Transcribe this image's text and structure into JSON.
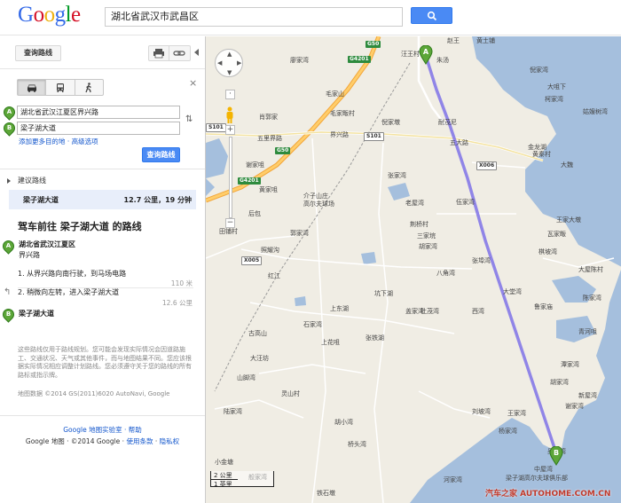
{
  "header": {
    "logo_letters": [
      "G",
      "o",
      "o",
      "g",
      "l",
      "e"
    ],
    "logo_colors": [
      "#3369e8",
      "#d50f25",
      "#eeb211",
      "#3369e8",
      "#009925",
      "#d50f25"
    ],
    "search_value": "湖北省武汉市武昌区"
  },
  "panel": {
    "top_button": "查询路线",
    "waypoints": [
      {
        "marker": "A",
        "value": "湖北省武汉江夏区界兴路"
      },
      {
        "marker": "B",
        "value": "梁子湖大道"
      }
    ],
    "add_destination": "添加更多目的地 · 高级选项",
    "get_directions_button": "查询路线",
    "suggested_label": "建议路线",
    "route": {
      "name": "梁子湖大道",
      "summary": "12.7 公里，19 分钟"
    },
    "directions_title": "驾车前往 梁子湖大道 的路线",
    "start": {
      "marker": "A",
      "line1": "湖北省武汉江夏区",
      "line2": "界兴路"
    },
    "steps": [
      {
        "text": "1. 从界兴路向南行驶，到马场电路",
        "distance": "110 米"
      },
      {
        "text": "2. 稍微向左转，进入梁子湖大道",
        "distance": "12.6 公里"
      }
    ],
    "end": {
      "marker": "B",
      "line1": "梁子湖大道"
    },
    "disclaimer": "这些路线仅用于路线规划。您可能会发现实际情况会因道路施工、交通状况、天气或其他事件，而与地图结果不同。您应该根据实际情况相应调整计划路线。您必须遵守关于您的路线的所有路标或指示牌。",
    "map_data": "地图数据 ©2014 GS(2011)6020 AutoNavi, Google",
    "footer_line1": "Google 地图实验室 · 帮助",
    "footer_line2_prefix": "Google 地图 · ©2014 Google · ",
    "footer_terms": "使用条款",
    "footer_privacy": "隐私权"
  },
  "map": {
    "scale_top": "2 公里",
    "scale_bottom": "1 英里",
    "watermark": "汽车之家  AUTOHOME.COM.CN",
    "route_color": "#7f72e8",
    "water_color": "#a5bfdd",
    "land_color": "#f0ede4",
    "labels": [
      "汪王村",
      "赵王",
      "黄土铺",
      "朱汤",
      "倪家湾",
      "大咀下",
      "柯家湾",
      "毛家山",
      "廖家湾",
      "肖郭家",
      "毛家畈村",
      "耐茂尼",
      "倪家墩",
      "姑嫂树湾",
      "五里界路",
      "界兴路",
      "五大路",
      "谢家咀",
      "张家湾",
      "大魏",
      "金龙湖",
      "黄秦村",
      "黄家咀",
      "介子山庄",
      "高尔夫球场",
      "老屋湾",
      "伍家湾",
      "王家大墩",
      "后包",
      "田铺村",
      "郭家湾",
      "荆桥村",
      "瓦家畈",
      "棋坡湾",
      "照耀沟",
      "三家垸",
      "胡家湾",
      "大屋陈村",
      "陈家湾",
      "张埠湾",
      "大堂湾",
      "鲁家庙",
      "坑下湖",
      "上东湖",
      "八角湾",
      "红江",
      "杜茂湾",
      "盖家湾",
      "古高山",
      "石家湾",
      "大汪坊",
      "西湾",
      "上花咀",
      "张铁湖",
      "山脚湾",
      "潭家湾",
      "青河咀",
      "胡家湾",
      "灵山村",
      "新屋湾",
      "谢家湾",
      "胡小湾",
      "陆家湾",
      "桥头湾",
      "刘坡湾",
      "王家湾",
      "杨家湾",
      "吴家湾",
      "中屋湾",
      "梁子湖高尔夫球俱乐部",
      "河家湾",
      "铁石墩",
      "般家湾",
      "小金塘"
    ],
    "shields": [
      "G50",
      "G4201",
      "G50",
      "G4201",
      "X006",
      "X005",
      "S101",
      "S101"
    ]
  }
}
